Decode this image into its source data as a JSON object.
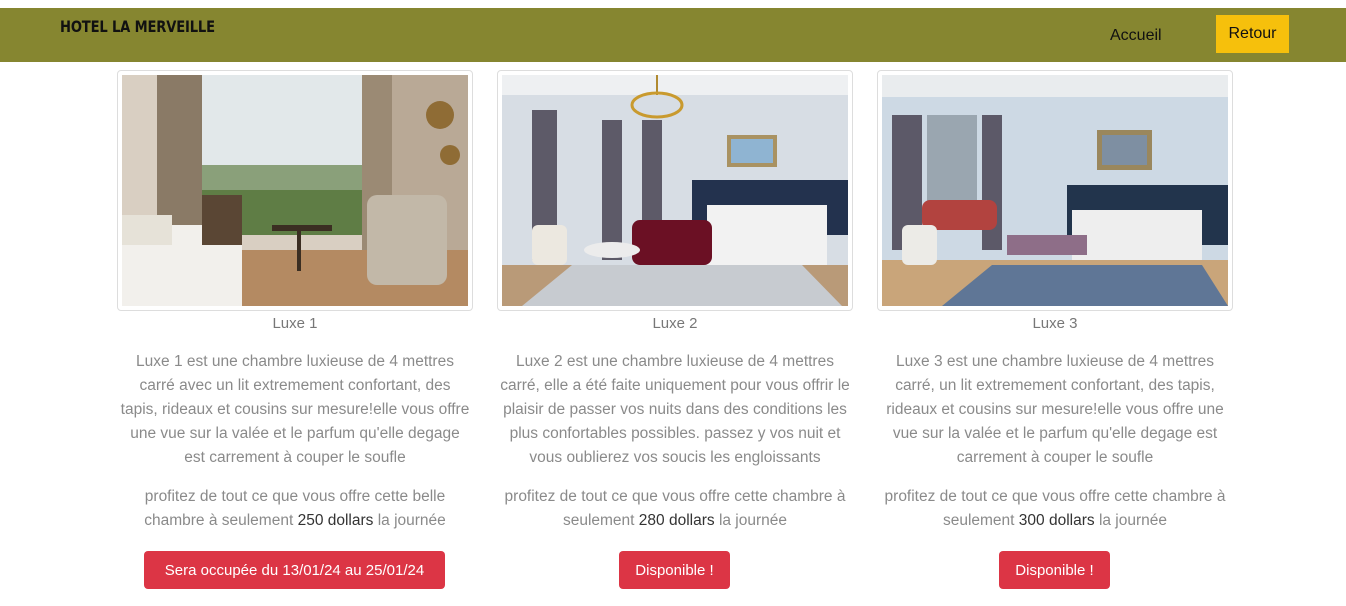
{
  "header": {
    "brand": "HOTEL LA MERVEILLE",
    "nav_home": "Accueil",
    "back_button": "Retour"
  },
  "rooms": [
    {
      "name": "Luxe 1",
      "description": "Luxe 1 est une chambre luxieuse de 4 mettres carré avec un lit extremement confortant, des tapis, rideaux et cousins sur mesure!elle vous offre une vue sur la valée et le parfum qu'elle degage est carrement à couper le soufle",
      "offer_prefix": "profitez de tout ce que vous offre cette belle chambre à seulement",
      "price": "250 dollars",
      "offer_suffix": "la journée",
      "status": "Sera occupée du 13/01/24 au 25/01/24"
    },
    {
      "name": "Luxe 2",
      "description": "Luxe 2 est une chambre luxieuse de 4 mettres carré, elle a été faite uniquement pour vous offrir le plaisir de passer vos nuits dans des conditions les plus confortables possibles. passez y vos nuit et vous oublierez vos soucis les engloissants",
      "offer_prefix": "profitez de tout ce que vous offre cette chambre à seulement",
      "price": "280 dollars",
      "offer_suffix": "la journée",
      "status": "Disponible !"
    },
    {
      "name": "Luxe 3",
      "description": "Luxe 3 est une chambre luxieuse de 4 mettres carré, un lit extremement confortant, des tapis, rideaux et cousins sur mesure!elle vous offre une vue sur la valée et le parfum qu'elle degage est carrement à couper le soufle",
      "offer_prefix": "profitez de tout ce que vous offre cette chambre à seulement",
      "price": "300 dollars",
      "offer_suffix": "la journée",
      "status": "Disponible !"
    }
  ],
  "colors": {
    "navbar": "#868630",
    "back_button": "#f6c00c",
    "status_button": "#dc3545"
  }
}
